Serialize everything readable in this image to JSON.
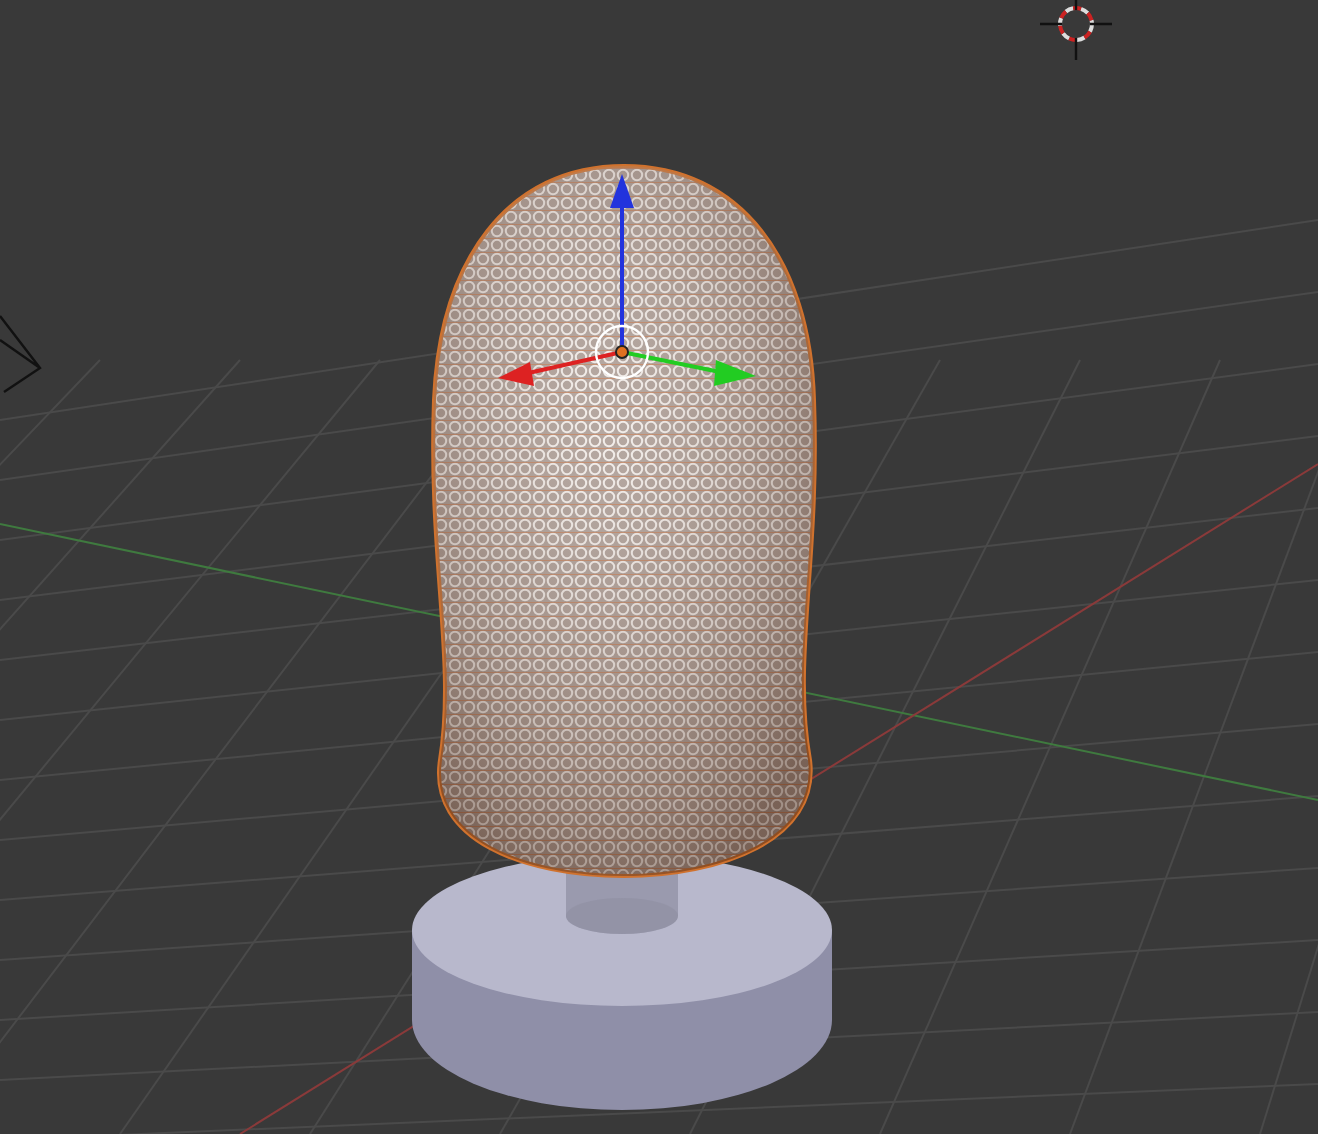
{
  "viewport": {
    "objects": [
      {
        "kind": "grid"
      },
      {
        "kind": "camera"
      },
      {
        "kind": "cursor"
      },
      {
        "kind": "pedestal"
      },
      {
        "kind": "mesh"
      },
      {
        "kind": "gizmo"
      }
    ]
  }
}
